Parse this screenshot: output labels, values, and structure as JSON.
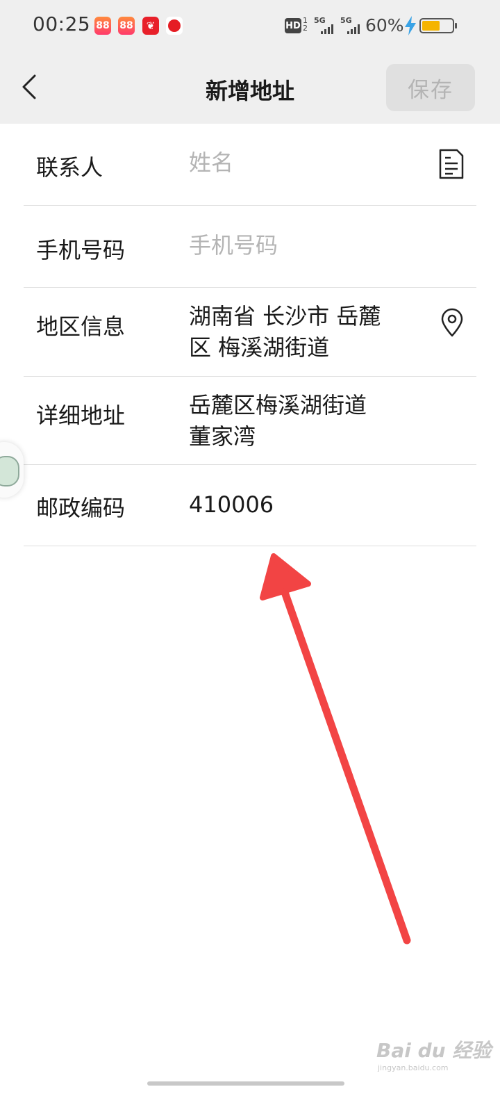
{
  "status_bar": {
    "time": "00:25",
    "hd_label": "HD",
    "hd_sub": "1\n2",
    "signal_1": "5G",
    "signal_2": "5G",
    "battery_percent": "60%",
    "battery_level": 0.6,
    "battery_color": "#f5b400",
    "app_icons": [
      "app-icon-1",
      "app-icon-2",
      "app-icon-3",
      "app-icon-4"
    ]
  },
  "nav": {
    "back_icon": "chevron-left-icon",
    "title": "新增地址",
    "save_label": "保存"
  },
  "form": {
    "contact": {
      "label": "联系人",
      "placeholder": "姓名",
      "icon": "contact-card-icon"
    },
    "phone": {
      "label": "手机号码",
      "placeholder": "手机号码"
    },
    "region": {
      "label": "地区信息",
      "value_line1": "湖南省 长沙市 岳麓",
      "value_line2": "区 梅溪湖街道",
      "icon": "location-pin-icon"
    },
    "address": {
      "label": "详细地址",
      "value_line1": "岳麓区梅溪湖街道",
      "value_line2": "董家湾"
    },
    "postcode": {
      "label": "邮政编码",
      "value": "410006"
    }
  },
  "annotation": {
    "arrow_color": "#f24444"
  },
  "watermark": {
    "text": "Bai du 经验",
    "sub": "jingyan.baidu.com"
  }
}
